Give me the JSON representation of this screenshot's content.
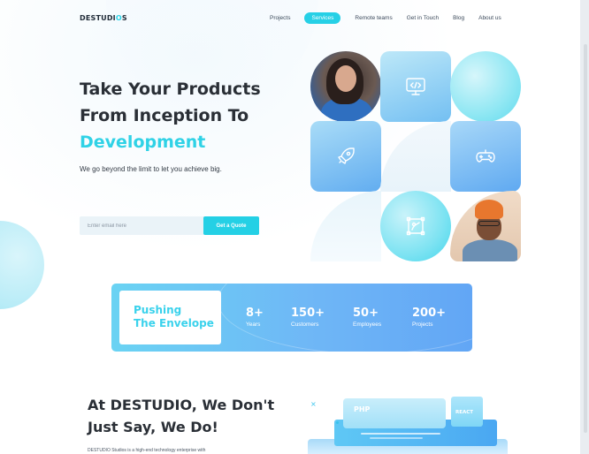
{
  "brand": {
    "logo_prefix": "DESTUDI",
    "logo_accent": "O",
    "logo_suffix": "S"
  },
  "nav": {
    "items": [
      {
        "label": "Projects",
        "active": false
      },
      {
        "label": "Services",
        "active": true
      },
      {
        "label": "Remote teams",
        "active": false
      },
      {
        "label": "Get in Touch",
        "active": false
      },
      {
        "label": "Blog",
        "active": false
      },
      {
        "label": "About us",
        "active": false
      }
    ]
  },
  "hero": {
    "title_line1": "Take Your Products",
    "title_line2": "From Inception To",
    "title_accent": "Development",
    "subtitle": "We go beyond the limit to let you achieve big.",
    "email_placeholder": "Enter email here",
    "cta_label": "Get a Quote"
  },
  "grid": {
    "icons": [
      "code-monitor-icon",
      "rocket-icon",
      "gamepad-icon",
      "design-tool-icon"
    ]
  },
  "stats": {
    "heading_line1": "Pushing",
    "heading_line2": "The Envelope",
    "items": [
      {
        "value": "8+",
        "caption": "Years"
      },
      {
        "value": "150+",
        "caption": "Customers"
      },
      {
        "value": "50+",
        "caption": "Employees"
      },
      {
        "value": "200+",
        "caption": "Projects"
      }
    ]
  },
  "about": {
    "title_line1": "At DESTUDIO, We Don't",
    "title_line2": "Just Say, We Do!",
    "text": "DESTUDIO Studios is a high-end technology enterprise with"
  },
  "illustration": {
    "php_label": "PHP",
    "react_label": "REACT"
  },
  "colors": {
    "accent": "#2bd4e8",
    "dark_text": "#2a2f36",
    "stats_gradient_start": "#6ad3f3",
    "stats_gradient_end": "#62a6f5"
  }
}
